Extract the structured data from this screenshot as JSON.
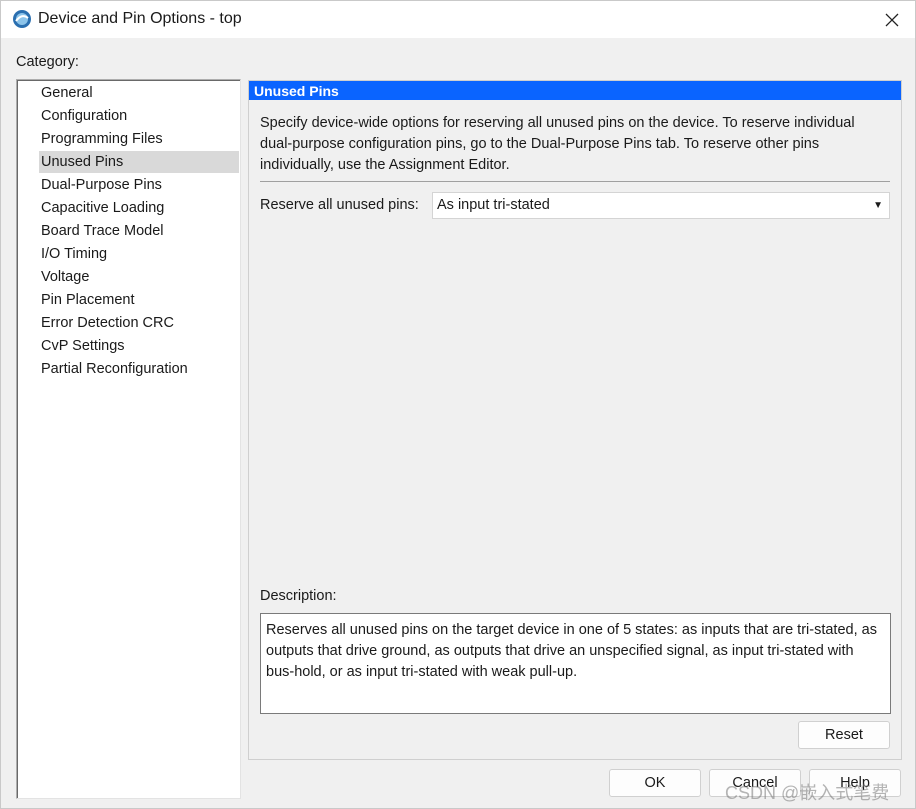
{
  "window": {
    "title": "Device and Pin Options - top",
    "app_icon": "quartus-app-icon",
    "close_icon": "close-icon"
  },
  "category": {
    "label": "Category:",
    "items": [
      "General",
      "Configuration",
      "Programming Files",
      "Unused Pins",
      "Dual-Purpose Pins",
      "Capacitive Loading",
      "Board Trace Model",
      "I/O Timing",
      "Voltage",
      "Pin Placement",
      "Error Detection CRC",
      "CvP Settings",
      "Partial Reconfiguration"
    ],
    "selected": "Unused Pins"
  },
  "panel": {
    "header": "Unused Pins",
    "intro": "Specify device-wide options for reserving all unused pins on the device. To reserve individual dual-purpose configuration pins, go to the Dual-Purpose Pins tab. To reserve other pins individually, use the Assignment Editor.",
    "reserve_label": "Reserve all unused pins:",
    "reserve_value": "As input tri-stated",
    "description_label": "Description:",
    "description_text": "Reserves all unused pins on the target device in one of 5 states: as inputs that are tri-stated, as outputs that drive ground, as outputs that drive an unspecified signal, as input tri-stated with bus-hold, or as input tri-stated with weak pull-up.",
    "reset_label": "Reset"
  },
  "footer": {
    "ok_label": "OK",
    "cancel_label": "Cancel",
    "help_label": "Help"
  },
  "watermark": "CSDN @嵌入式笔费",
  "colors": {
    "header_bg": "#0a64ff",
    "selected_bg": "#d9d9d9"
  }
}
